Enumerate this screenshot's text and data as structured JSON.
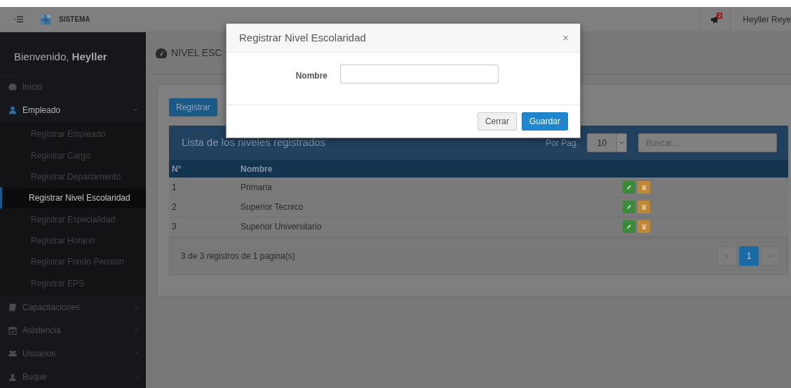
{
  "header": {
    "brand": "SISTEMA",
    "notification_count": "2",
    "user": "Heyller Reye"
  },
  "sidebar": {
    "welcome": "Bienvenido, **Heyller**",
    "items": [
      {
        "label": "Inicio",
        "kind": "link",
        "expanded": false
      },
      {
        "label": "Empleado",
        "kind": "menu",
        "expanded": true,
        "children": [
          {
            "label": "Registrar Empleado",
            "selected": false
          },
          {
            "label": "Registrar Cargo",
            "selected": false
          },
          {
            "label": "Registrar Departamento",
            "selected": false
          },
          {
            "label": "Registrar Nivel Escolaridad",
            "selected": true
          },
          {
            "label": "Registrar Especialidad",
            "selected": false
          },
          {
            "label": "Registrar Horario",
            "selected": false
          },
          {
            "label": "Registrar Fondo Pension",
            "selected": false
          },
          {
            "label": "Registrar EPS",
            "selected": false
          }
        ]
      },
      {
        "label": "Capacitaciones",
        "kind": "menu",
        "expanded": false
      },
      {
        "label": "Asistencia",
        "kind": "menu",
        "expanded": false
      },
      {
        "label": "Usuarios",
        "kind": "menu",
        "expanded": false
      },
      {
        "label": "Buque",
        "kind": "menu",
        "expanded": false
      }
    ]
  },
  "page_title": "NIVEL ESC",
  "panel": {
    "register_button": "Registrar",
    "list_title": "Lista de los niveles registrados",
    "per_page_label": "Por Pag.",
    "per_page": "10",
    "search": {
      "placeholder": "Buscar..."
    },
    "table": {
      "columns": [
        "N°",
        "Nombre"
      ],
      "rows": [
        {
          "number": "1",
          "name": "Primaria"
        },
        {
          "number": "2",
          "name": "Superior Tecnico"
        },
        {
          "number": "3",
          "name": "Superior Universitario"
        }
      ]
    },
    "footer_text": "3 de 3 registros de 1 pagina(s)",
    "pagination": [
      {
        "label": "«",
        "selected": false
      },
      {
        "label": "1",
        "selected": true
      },
      {
        "label": "»",
        "selected": false
      }
    ]
  },
  "modal": {
    "title": "Registrar Nivel Escolaridad",
    "close": "×",
    "field_label": "Nombre",
    "buttons": [
      {
        "label": "Cerrar",
        "kind": "secondary"
      },
      {
        "label": "Guardar",
        "kind": "primary"
      }
    ]
  }
}
